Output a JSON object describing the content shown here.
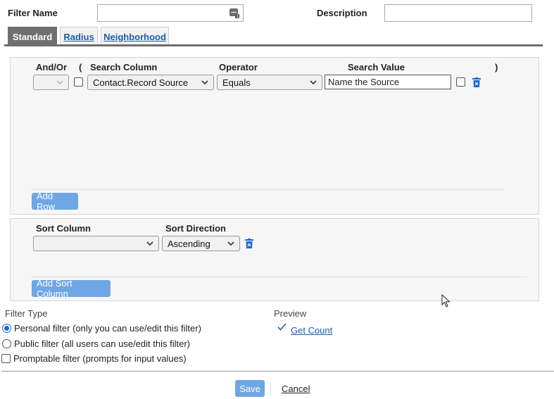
{
  "header": {
    "filter_name_label": "Filter Name",
    "filter_name_value": "",
    "description_label": "Description",
    "description_value": ""
  },
  "tabs": [
    {
      "label": "Standard",
      "active": true
    },
    {
      "label": "Radius",
      "active": false
    },
    {
      "label": "Neighborhood",
      "active": false
    }
  ],
  "criteria": {
    "headers": {
      "and_or": "And/Or",
      "open_paren": "(",
      "search_column": "Search Column",
      "operator": "Operator",
      "search_value": "Search Value",
      "close_paren": ")"
    },
    "row": {
      "and_or": "",
      "open_paren_checked": false,
      "search_column": "Contact.Record Source",
      "operator": "Equals",
      "search_value": "Name the Source",
      "close_paren_checked": false
    },
    "add_row_label": "Add Row"
  },
  "sort": {
    "headers": {
      "sort_column": "Sort Column",
      "sort_direction": "Sort Direction"
    },
    "row": {
      "sort_column": "",
      "sort_direction": "Ascending"
    },
    "add_sort_label": "Add Sort Column"
  },
  "filter_type": {
    "label": "Filter Type",
    "options": [
      {
        "label": "Personal filter (only you can use/edit this filter)",
        "selected": true
      },
      {
        "label": "Public filter (all users can use/edit this filter)",
        "selected": false
      }
    ],
    "promptable_label": "Promptable filter (prompts for input values)",
    "promptable_checked": false
  },
  "preview": {
    "label": "Preview",
    "get_count_label": "Get Count"
  },
  "footer": {
    "save_label": "Save",
    "cancel_label": "Cancel"
  },
  "colors": {
    "accent": "#6fa6e5",
    "tab_active": "#6f6f6f",
    "link": "#1a5ea8",
    "trash": "#1a6ad6"
  }
}
